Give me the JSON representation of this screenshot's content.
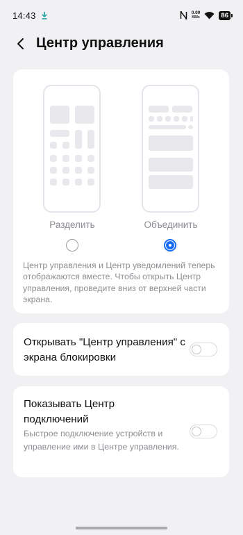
{
  "status_bar": {
    "time": "14:43",
    "net_speed_value": "0.00",
    "net_speed_unit": "KB/s",
    "battery": "86",
    "icons": [
      "download-icon",
      "nfc-icon",
      "wifi-icon",
      "battery-icon"
    ]
  },
  "header": {
    "title": "Центр управления",
    "back_icon": "chevron-left-icon"
  },
  "layout_options": {
    "split_label": "Разделить",
    "merge_label": "Объединить",
    "selected": "merge",
    "accent_color": "#1a6ef5",
    "description": "Центр управления и Центр уведомлений теперь отображаются вместе. Чтобы открыть Центр управления, проведите вниз от верхней части экрана."
  },
  "settings": {
    "lock_screen": {
      "title": "Открывать \"Центр управления\" с экрана блокировки",
      "enabled": false
    },
    "connections": {
      "title": "Показывать Центр подключений",
      "subtitle": "Быстрое подключение устройств и управление ими в Центре управления.",
      "enabled": false
    }
  }
}
